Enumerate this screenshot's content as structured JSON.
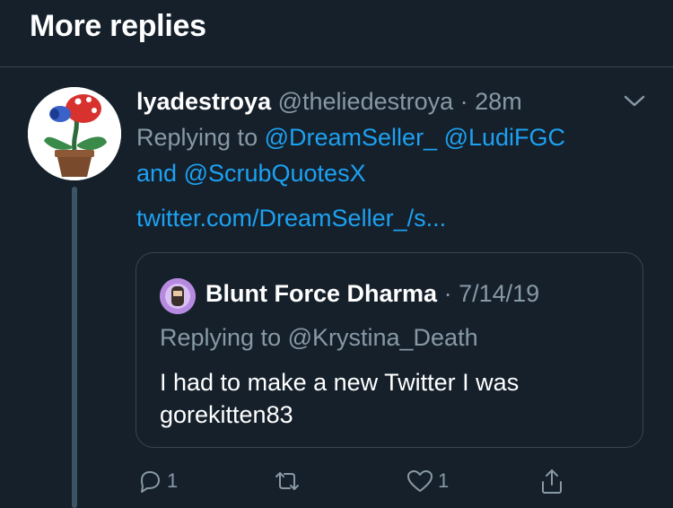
{
  "header": {
    "title": "More replies"
  },
  "tweet": {
    "display_name": "lyadestroya",
    "handle": "@theliedestroya",
    "separator": "·",
    "time": "28m",
    "replying_prefix": "Replying to",
    "mention_1": "@DreamSeller_",
    "mention_2": "@LudiFGC",
    "and_word": "and",
    "mention_3": "@ScrubQuotesX",
    "link": "twitter.com/DreamSeller_/s..."
  },
  "quote": {
    "display_name": "Blunt Force Dharma",
    "separator": "·",
    "date": "7/14/19",
    "replying": "Replying to @Krystina_Death",
    "text_line1": "I had to make a new Twitter I was",
    "text_line2": "gorekitten83"
  },
  "actions": {
    "reply_count": "1",
    "like_count": "1"
  },
  "icons": {
    "reply": "reply-icon",
    "retweet": "retweet-icon",
    "like": "heart-icon",
    "share": "share-icon",
    "chevron": "chevron-down-icon"
  },
  "colors": {
    "background": "#15202b",
    "link": "#1da1f2",
    "muted": "#8899a6",
    "border": "#38444d"
  }
}
